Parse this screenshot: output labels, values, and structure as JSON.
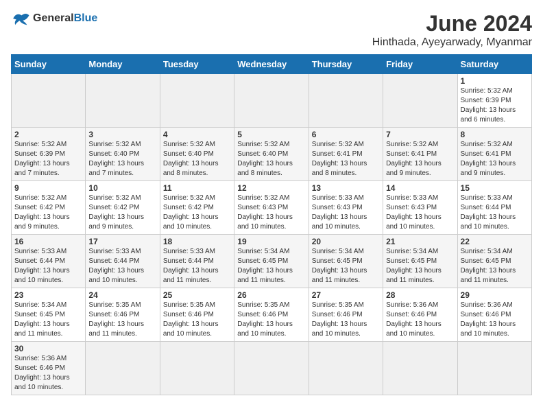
{
  "header": {
    "logo_general": "General",
    "logo_blue": "Blue",
    "month_year": "June 2024",
    "location": "Hinthada, Ayeyarwady, Myanmar"
  },
  "weekdays": [
    "Sunday",
    "Monday",
    "Tuesday",
    "Wednesday",
    "Thursday",
    "Friday",
    "Saturday"
  ],
  "weeks": [
    [
      {
        "day": "",
        "info": ""
      },
      {
        "day": "",
        "info": ""
      },
      {
        "day": "",
        "info": ""
      },
      {
        "day": "",
        "info": ""
      },
      {
        "day": "",
        "info": ""
      },
      {
        "day": "",
        "info": ""
      },
      {
        "day": "1",
        "info": "Sunrise: 5:32 AM\nSunset: 6:39 PM\nDaylight: 13 hours and 6 minutes."
      }
    ],
    [
      {
        "day": "2",
        "info": "Sunrise: 5:32 AM\nSunset: 6:39 PM\nDaylight: 13 hours and 7 minutes."
      },
      {
        "day": "3",
        "info": "Sunrise: 5:32 AM\nSunset: 6:40 PM\nDaylight: 13 hours and 7 minutes."
      },
      {
        "day": "4",
        "info": "Sunrise: 5:32 AM\nSunset: 6:40 PM\nDaylight: 13 hours and 8 minutes."
      },
      {
        "day": "5",
        "info": "Sunrise: 5:32 AM\nSunset: 6:40 PM\nDaylight: 13 hours and 8 minutes."
      },
      {
        "day": "6",
        "info": "Sunrise: 5:32 AM\nSunset: 6:41 PM\nDaylight: 13 hours and 8 minutes."
      },
      {
        "day": "7",
        "info": "Sunrise: 5:32 AM\nSunset: 6:41 PM\nDaylight: 13 hours and 9 minutes."
      },
      {
        "day": "8",
        "info": "Sunrise: 5:32 AM\nSunset: 6:41 PM\nDaylight: 13 hours and 9 minutes."
      }
    ],
    [
      {
        "day": "9",
        "info": "Sunrise: 5:32 AM\nSunset: 6:42 PM\nDaylight: 13 hours and 9 minutes."
      },
      {
        "day": "10",
        "info": "Sunrise: 5:32 AM\nSunset: 6:42 PM\nDaylight: 13 hours and 9 minutes."
      },
      {
        "day": "11",
        "info": "Sunrise: 5:32 AM\nSunset: 6:42 PM\nDaylight: 13 hours and 10 minutes."
      },
      {
        "day": "12",
        "info": "Sunrise: 5:32 AM\nSunset: 6:43 PM\nDaylight: 13 hours and 10 minutes."
      },
      {
        "day": "13",
        "info": "Sunrise: 5:33 AM\nSunset: 6:43 PM\nDaylight: 13 hours and 10 minutes."
      },
      {
        "day": "14",
        "info": "Sunrise: 5:33 AM\nSunset: 6:43 PM\nDaylight: 13 hours and 10 minutes."
      },
      {
        "day": "15",
        "info": "Sunrise: 5:33 AM\nSunset: 6:44 PM\nDaylight: 13 hours and 10 minutes."
      }
    ],
    [
      {
        "day": "16",
        "info": "Sunrise: 5:33 AM\nSunset: 6:44 PM\nDaylight: 13 hours and 10 minutes."
      },
      {
        "day": "17",
        "info": "Sunrise: 5:33 AM\nSunset: 6:44 PM\nDaylight: 13 hours and 10 minutes."
      },
      {
        "day": "18",
        "info": "Sunrise: 5:33 AM\nSunset: 6:44 PM\nDaylight: 13 hours and 11 minutes."
      },
      {
        "day": "19",
        "info": "Sunrise: 5:34 AM\nSunset: 6:45 PM\nDaylight: 13 hours and 11 minutes."
      },
      {
        "day": "20",
        "info": "Sunrise: 5:34 AM\nSunset: 6:45 PM\nDaylight: 13 hours and 11 minutes."
      },
      {
        "day": "21",
        "info": "Sunrise: 5:34 AM\nSunset: 6:45 PM\nDaylight: 13 hours and 11 minutes."
      },
      {
        "day": "22",
        "info": "Sunrise: 5:34 AM\nSunset: 6:45 PM\nDaylight: 13 hours and 11 minutes."
      }
    ],
    [
      {
        "day": "23",
        "info": "Sunrise: 5:34 AM\nSunset: 6:45 PM\nDaylight: 13 hours and 11 minutes."
      },
      {
        "day": "24",
        "info": "Sunrise: 5:35 AM\nSunset: 6:46 PM\nDaylight: 13 hours and 11 minutes."
      },
      {
        "day": "25",
        "info": "Sunrise: 5:35 AM\nSunset: 6:46 PM\nDaylight: 13 hours and 10 minutes."
      },
      {
        "day": "26",
        "info": "Sunrise: 5:35 AM\nSunset: 6:46 PM\nDaylight: 13 hours and 10 minutes."
      },
      {
        "day": "27",
        "info": "Sunrise: 5:35 AM\nSunset: 6:46 PM\nDaylight: 13 hours and 10 minutes."
      },
      {
        "day": "28",
        "info": "Sunrise: 5:36 AM\nSunset: 6:46 PM\nDaylight: 13 hours and 10 minutes."
      },
      {
        "day": "29",
        "info": "Sunrise: 5:36 AM\nSunset: 6:46 PM\nDaylight: 13 hours and 10 minutes."
      }
    ],
    [
      {
        "day": "30",
        "info": "Sunrise: 5:36 AM\nSunset: 6:46 PM\nDaylight: 13 hours and 10 minutes."
      },
      {
        "day": "",
        "info": ""
      },
      {
        "day": "",
        "info": ""
      },
      {
        "day": "",
        "info": ""
      },
      {
        "day": "",
        "info": ""
      },
      {
        "day": "",
        "info": ""
      },
      {
        "day": "",
        "info": ""
      }
    ]
  ]
}
